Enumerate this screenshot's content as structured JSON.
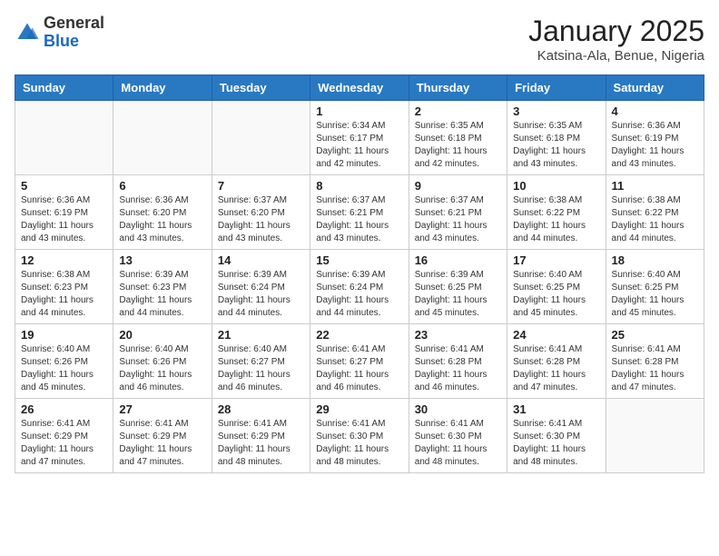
{
  "header": {
    "logo_general": "General",
    "logo_blue": "Blue",
    "month_title": "January 2025",
    "location": "Katsina-Ala, Benue, Nigeria"
  },
  "days_of_week": [
    "Sunday",
    "Monday",
    "Tuesday",
    "Wednesday",
    "Thursday",
    "Friday",
    "Saturday"
  ],
  "weeks": [
    [
      {
        "day": "",
        "info": ""
      },
      {
        "day": "",
        "info": ""
      },
      {
        "day": "",
        "info": ""
      },
      {
        "day": "1",
        "info": "Sunrise: 6:34 AM\nSunset: 6:17 PM\nDaylight: 11 hours and 42 minutes."
      },
      {
        "day": "2",
        "info": "Sunrise: 6:35 AM\nSunset: 6:18 PM\nDaylight: 11 hours and 42 minutes."
      },
      {
        "day": "3",
        "info": "Sunrise: 6:35 AM\nSunset: 6:18 PM\nDaylight: 11 hours and 43 minutes."
      },
      {
        "day": "4",
        "info": "Sunrise: 6:36 AM\nSunset: 6:19 PM\nDaylight: 11 hours and 43 minutes."
      }
    ],
    [
      {
        "day": "5",
        "info": "Sunrise: 6:36 AM\nSunset: 6:19 PM\nDaylight: 11 hours and 43 minutes."
      },
      {
        "day": "6",
        "info": "Sunrise: 6:36 AM\nSunset: 6:20 PM\nDaylight: 11 hours and 43 minutes."
      },
      {
        "day": "7",
        "info": "Sunrise: 6:37 AM\nSunset: 6:20 PM\nDaylight: 11 hours and 43 minutes."
      },
      {
        "day": "8",
        "info": "Sunrise: 6:37 AM\nSunset: 6:21 PM\nDaylight: 11 hours and 43 minutes."
      },
      {
        "day": "9",
        "info": "Sunrise: 6:37 AM\nSunset: 6:21 PM\nDaylight: 11 hours and 43 minutes."
      },
      {
        "day": "10",
        "info": "Sunrise: 6:38 AM\nSunset: 6:22 PM\nDaylight: 11 hours and 44 minutes."
      },
      {
        "day": "11",
        "info": "Sunrise: 6:38 AM\nSunset: 6:22 PM\nDaylight: 11 hours and 44 minutes."
      }
    ],
    [
      {
        "day": "12",
        "info": "Sunrise: 6:38 AM\nSunset: 6:23 PM\nDaylight: 11 hours and 44 minutes."
      },
      {
        "day": "13",
        "info": "Sunrise: 6:39 AM\nSunset: 6:23 PM\nDaylight: 11 hours and 44 minutes."
      },
      {
        "day": "14",
        "info": "Sunrise: 6:39 AM\nSunset: 6:24 PM\nDaylight: 11 hours and 44 minutes."
      },
      {
        "day": "15",
        "info": "Sunrise: 6:39 AM\nSunset: 6:24 PM\nDaylight: 11 hours and 44 minutes."
      },
      {
        "day": "16",
        "info": "Sunrise: 6:39 AM\nSunset: 6:25 PM\nDaylight: 11 hours and 45 minutes."
      },
      {
        "day": "17",
        "info": "Sunrise: 6:40 AM\nSunset: 6:25 PM\nDaylight: 11 hours and 45 minutes."
      },
      {
        "day": "18",
        "info": "Sunrise: 6:40 AM\nSunset: 6:25 PM\nDaylight: 11 hours and 45 minutes."
      }
    ],
    [
      {
        "day": "19",
        "info": "Sunrise: 6:40 AM\nSunset: 6:26 PM\nDaylight: 11 hours and 45 minutes."
      },
      {
        "day": "20",
        "info": "Sunrise: 6:40 AM\nSunset: 6:26 PM\nDaylight: 11 hours and 46 minutes."
      },
      {
        "day": "21",
        "info": "Sunrise: 6:40 AM\nSunset: 6:27 PM\nDaylight: 11 hours and 46 minutes."
      },
      {
        "day": "22",
        "info": "Sunrise: 6:41 AM\nSunset: 6:27 PM\nDaylight: 11 hours and 46 minutes."
      },
      {
        "day": "23",
        "info": "Sunrise: 6:41 AM\nSunset: 6:28 PM\nDaylight: 11 hours and 46 minutes."
      },
      {
        "day": "24",
        "info": "Sunrise: 6:41 AM\nSunset: 6:28 PM\nDaylight: 11 hours and 47 minutes."
      },
      {
        "day": "25",
        "info": "Sunrise: 6:41 AM\nSunset: 6:28 PM\nDaylight: 11 hours and 47 minutes."
      }
    ],
    [
      {
        "day": "26",
        "info": "Sunrise: 6:41 AM\nSunset: 6:29 PM\nDaylight: 11 hours and 47 minutes."
      },
      {
        "day": "27",
        "info": "Sunrise: 6:41 AM\nSunset: 6:29 PM\nDaylight: 11 hours and 47 minutes."
      },
      {
        "day": "28",
        "info": "Sunrise: 6:41 AM\nSunset: 6:29 PM\nDaylight: 11 hours and 48 minutes."
      },
      {
        "day": "29",
        "info": "Sunrise: 6:41 AM\nSunset: 6:30 PM\nDaylight: 11 hours and 48 minutes."
      },
      {
        "day": "30",
        "info": "Sunrise: 6:41 AM\nSunset: 6:30 PM\nDaylight: 11 hours and 48 minutes."
      },
      {
        "day": "31",
        "info": "Sunrise: 6:41 AM\nSunset: 6:30 PM\nDaylight: 11 hours and 48 minutes."
      },
      {
        "day": "",
        "info": ""
      }
    ]
  ]
}
